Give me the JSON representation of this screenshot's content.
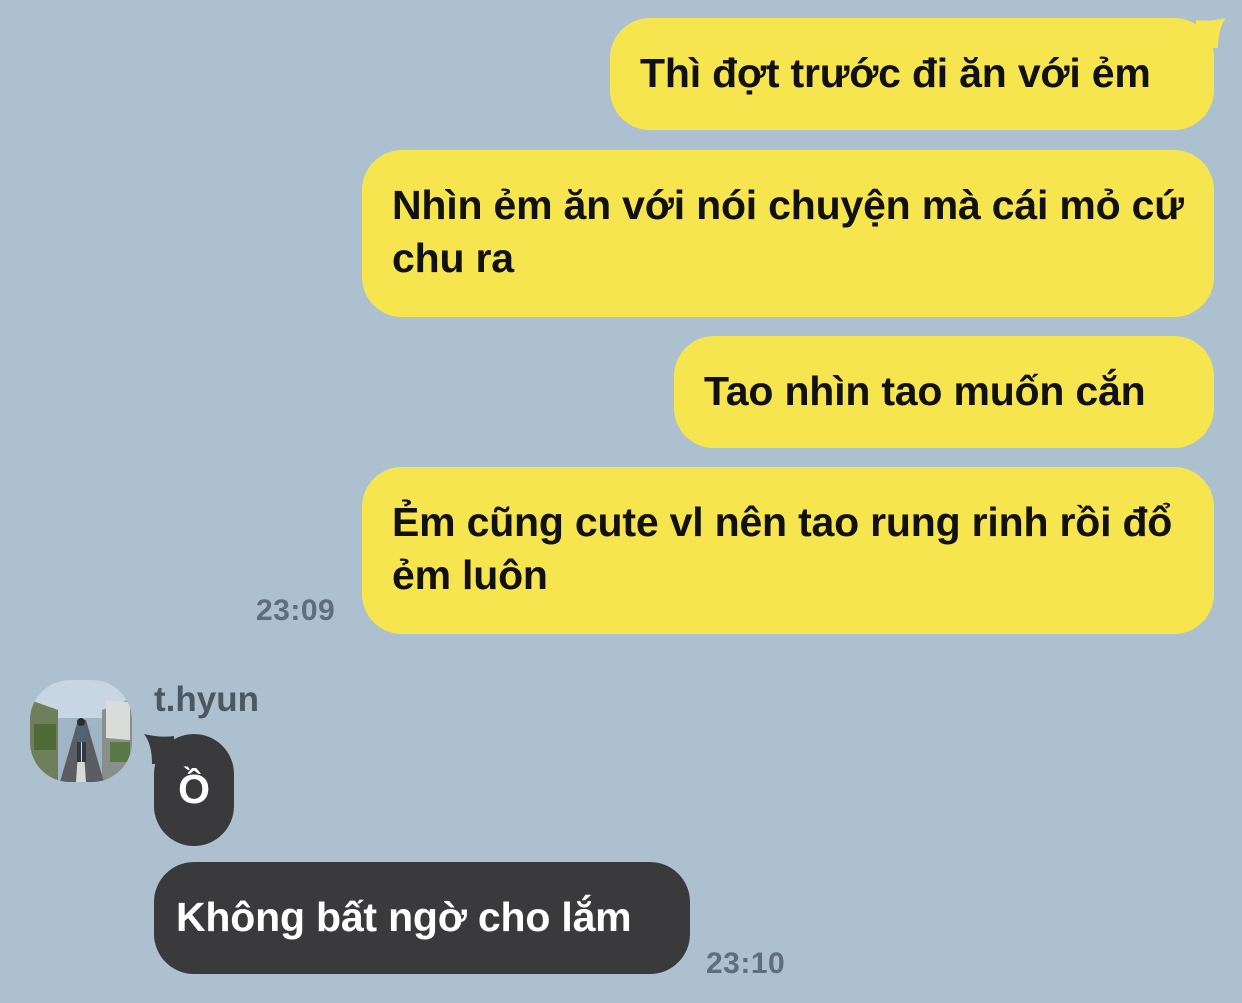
{
  "conversation": {
    "outgoing": [
      {
        "text": "Thì đợt trước đi ăn với ẻm"
      },
      {
        "text": "Nhìn ẻm ăn với nói chuyện mà cái mỏ cứ chu ra"
      },
      {
        "text": "Tao nhìn tao muốn cắn"
      },
      {
        "text": "Ẻm cũng cute vl nên tao rung rinh rồi đổ ẻm luôn"
      }
    ],
    "outgoing_time": "23:09",
    "incoming": {
      "sender": "t.hyun",
      "messages": [
        {
          "text": "Ồ"
        },
        {
          "text": "Không bất ngờ cho lắm"
        }
      ],
      "time": "23:10"
    }
  },
  "colors": {
    "background": "#adc0cf",
    "outgoing_bubble": "#f7e54f",
    "incoming_bubble": "#3a3a3c",
    "timestamp": "#5e6e7a"
  },
  "icons": {
    "avatar": "user-photo-avatar"
  }
}
